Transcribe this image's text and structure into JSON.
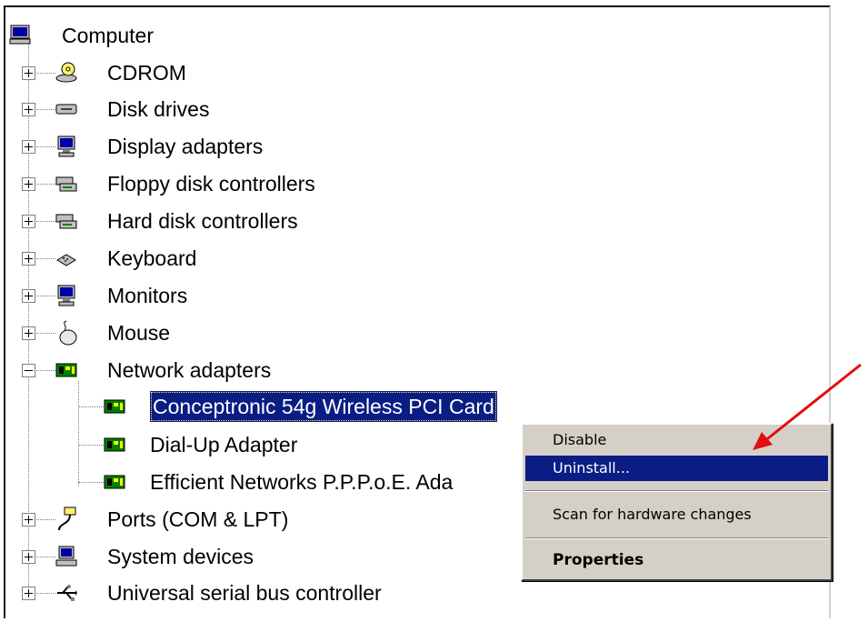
{
  "tree": {
    "root": {
      "label": "Computer",
      "icon": "computer-icon"
    },
    "categories": [
      {
        "label": "CDROM",
        "icon": "cdrom-icon",
        "expanded": false
      },
      {
        "label": "Disk drives",
        "icon": "disk-drive-icon",
        "expanded": false
      },
      {
        "label": "Display adapters",
        "icon": "display-adapter-icon",
        "expanded": false
      },
      {
        "label": "Floppy disk controllers",
        "icon": "floppy-controller-icon",
        "expanded": false
      },
      {
        "label": "Hard disk controllers",
        "icon": "hard-disk-controller-icon",
        "expanded": false
      },
      {
        "label": "Keyboard",
        "icon": "keyboard-icon",
        "expanded": false
      },
      {
        "label": "Monitors",
        "icon": "monitor-icon",
        "expanded": false
      },
      {
        "label": "Mouse",
        "icon": "mouse-icon",
        "expanded": false
      },
      {
        "label": "Network adapters",
        "icon": "network-adapter-icon",
        "expanded": true
      },
      {
        "label": "Ports (COM & LPT)",
        "icon": "port-icon",
        "expanded": false
      },
      {
        "label": "System devices",
        "icon": "system-devices-icon",
        "expanded": false
      },
      {
        "label": "Universal serial bus controller",
        "icon": "usb-icon",
        "expanded": false
      }
    ],
    "network_children": [
      {
        "label": "Conceptronic 54g Wireless PCI Card",
        "icon": "network-card-icon",
        "selected": true
      },
      {
        "label": "Dial-Up Adapter",
        "icon": "network-card-icon",
        "selected": false
      },
      {
        "label": "Efficient Networks P.P.P.o.E. Ada",
        "icon": "network-card-icon",
        "selected": false
      }
    ]
  },
  "context_menu": {
    "items": [
      {
        "label": "Disable",
        "highlighted": false,
        "bold": false
      },
      {
        "label": "Uninstall...",
        "highlighted": true,
        "bold": false
      },
      {
        "label": "Scan for hardware changes",
        "highlighted": false,
        "bold": false
      },
      {
        "label": "Properties",
        "highlighted": false,
        "bold": true
      }
    ]
  },
  "annotation": {
    "type": "red-arrow",
    "color": "#e01010"
  },
  "colors": {
    "selection": "#0a1d84",
    "menu_bg": "#d4d0c8"
  }
}
